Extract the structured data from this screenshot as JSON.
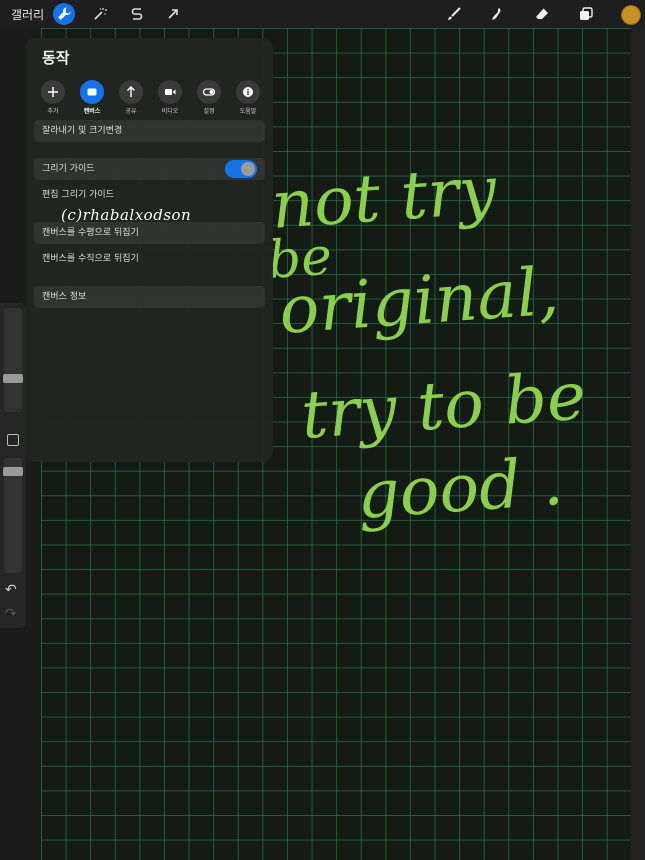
{
  "topbar": {
    "gallery_label": "갤러리",
    "left_tools": [
      "wrench-icon",
      "magic-wand-icon",
      "selection-s-icon",
      "transform-arrow-icon"
    ],
    "right_tools": [
      "brush-icon",
      "smudge-icon",
      "eraser-icon",
      "layers-icon"
    ],
    "color": "#c8921e",
    "accent": "#1673e6"
  },
  "panel": {
    "title": "동작",
    "tabs": [
      {
        "label": "추가",
        "icon": "plus-icon"
      },
      {
        "label": "캔버스",
        "icon": "canvas-icon"
      },
      {
        "label": "공유",
        "icon": "share-arrow-icon"
      },
      {
        "label": "비디오",
        "icon": "video-icon"
      },
      {
        "label": "설정",
        "icon": "toggle-icon"
      },
      {
        "label": "도움말",
        "icon": "info-icon"
      }
    ],
    "rows": {
      "crop": "잘라내기 및 크기변경",
      "drawing_guide": "그리기 가이드",
      "edit_guide": "편집 그리기 가이드",
      "flip_h": "캔버스를 수평으로 뒤집기",
      "flip_v": "캔버스를 수직으로 뒤집기",
      "info": "캔버스 정보"
    },
    "drawing_guide_enabled": true
  },
  "watermark": "(c)rhabalxodson",
  "canvas": {
    "lines": [
      "not try",
      "be",
      "original,",
      "try to be",
      "good ."
    ],
    "ink_color": "#8ccf4c"
  }
}
